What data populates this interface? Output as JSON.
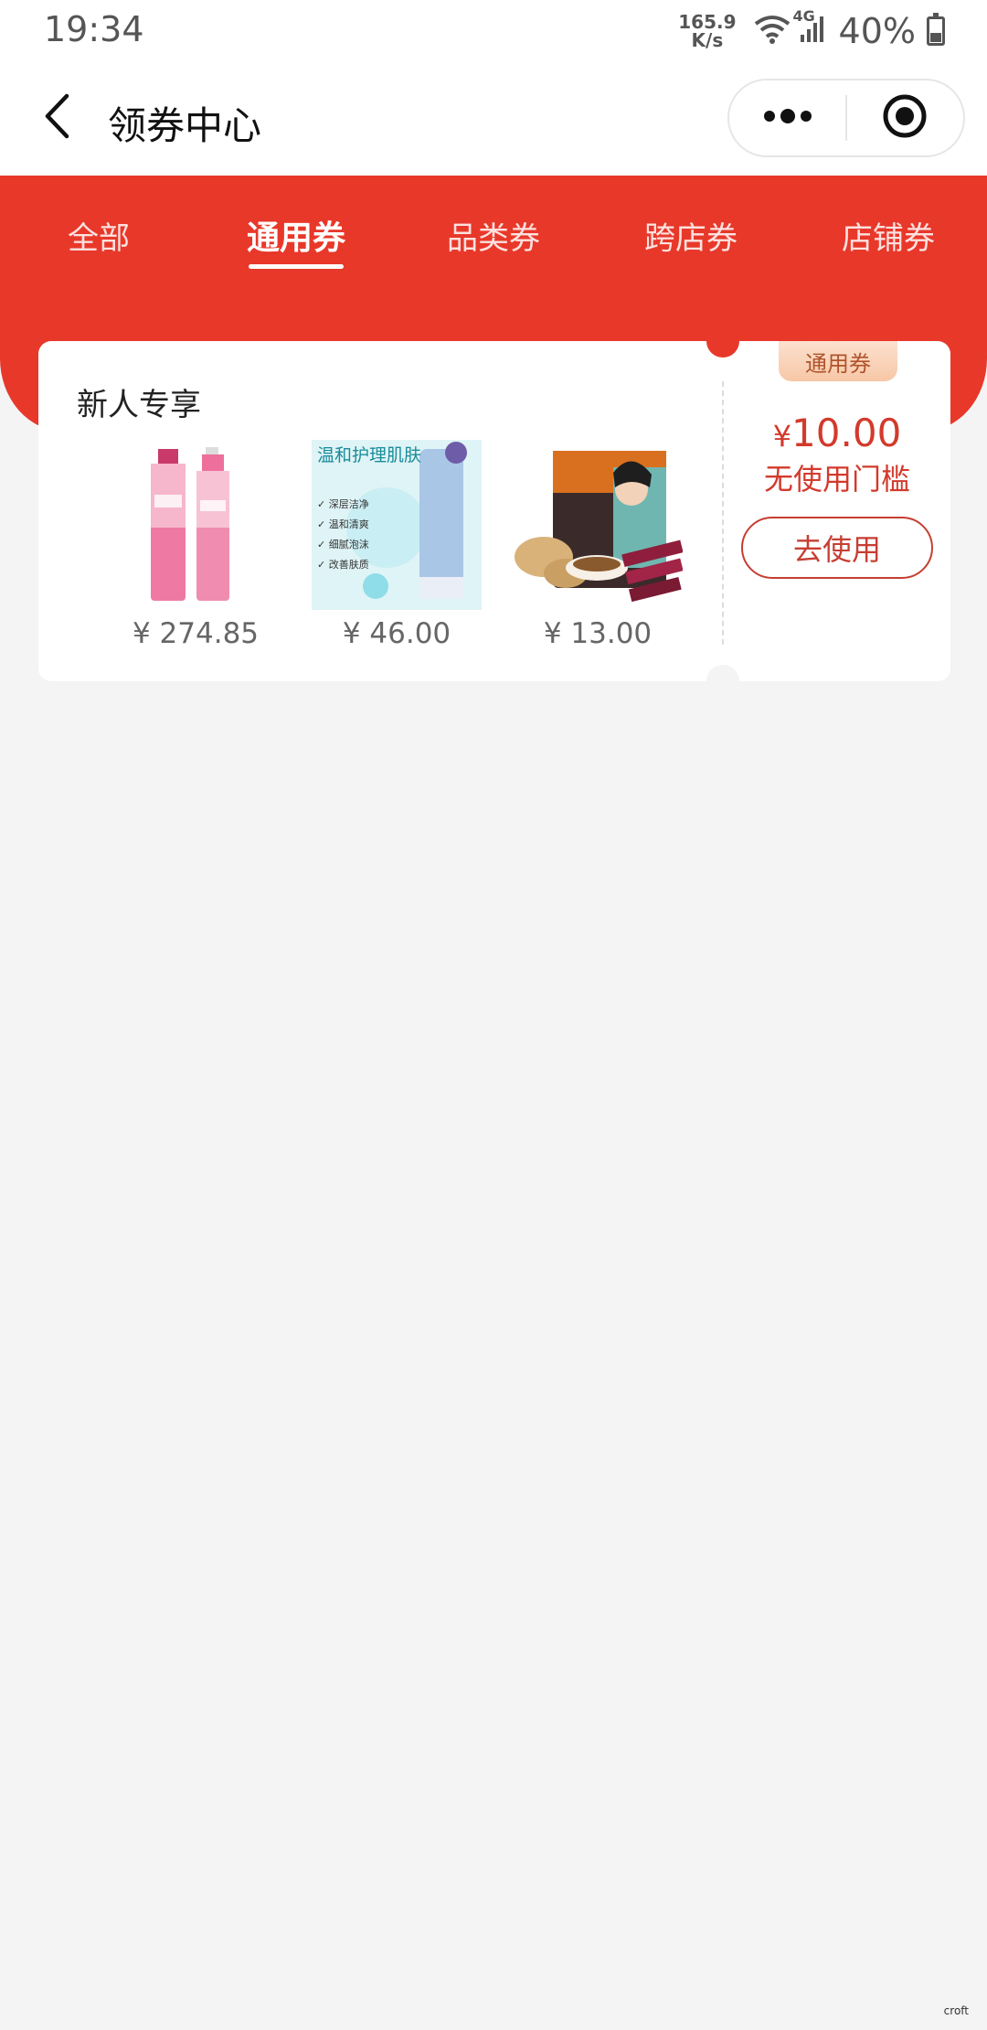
{
  "status_bar": {
    "time": "19:34",
    "net_speed_value": "165.9",
    "net_speed_unit": "K/s",
    "network": "4G",
    "battery": "40%",
    "battery_level": 0.4
  },
  "title_bar": {
    "title": "领券中心",
    "back_icon": "chevron-left-icon",
    "more_icon": "more-dots-icon",
    "close_icon": "target-icon"
  },
  "tabs": [
    {
      "label": "全部",
      "active": false
    },
    {
      "label": "通用券",
      "active": true
    },
    {
      "label": "品类券",
      "active": false
    },
    {
      "label": "跨店券",
      "active": false
    },
    {
      "label": "店铺券",
      "active": false
    }
  ],
  "coupon": {
    "heading": "新人专享",
    "badge": "通用券",
    "amount_symbol": "¥",
    "amount": "10.00",
    "threshold": "无使用门槛",
    "use_button": "去使用",
    "products": [
      {
        "price": "¥ 274.85",
        "image": "pink-toner-bottles"
      },
      {
        "price": "¥ 46.00",
        "image": "facial-cleanser-tube",
        "image_text": "温和护理肌肤"
      },
      {
        "price": "¥ 13.00",
        "image": "ginger-tea-pack"
      }
    ]
  },
  "colors": {
    "brand_red": "#e8382a",
    "coupon_red": "#d33a2c",
    "background": "#f4f4f4"
  },
  "watermark": "croft"
}
